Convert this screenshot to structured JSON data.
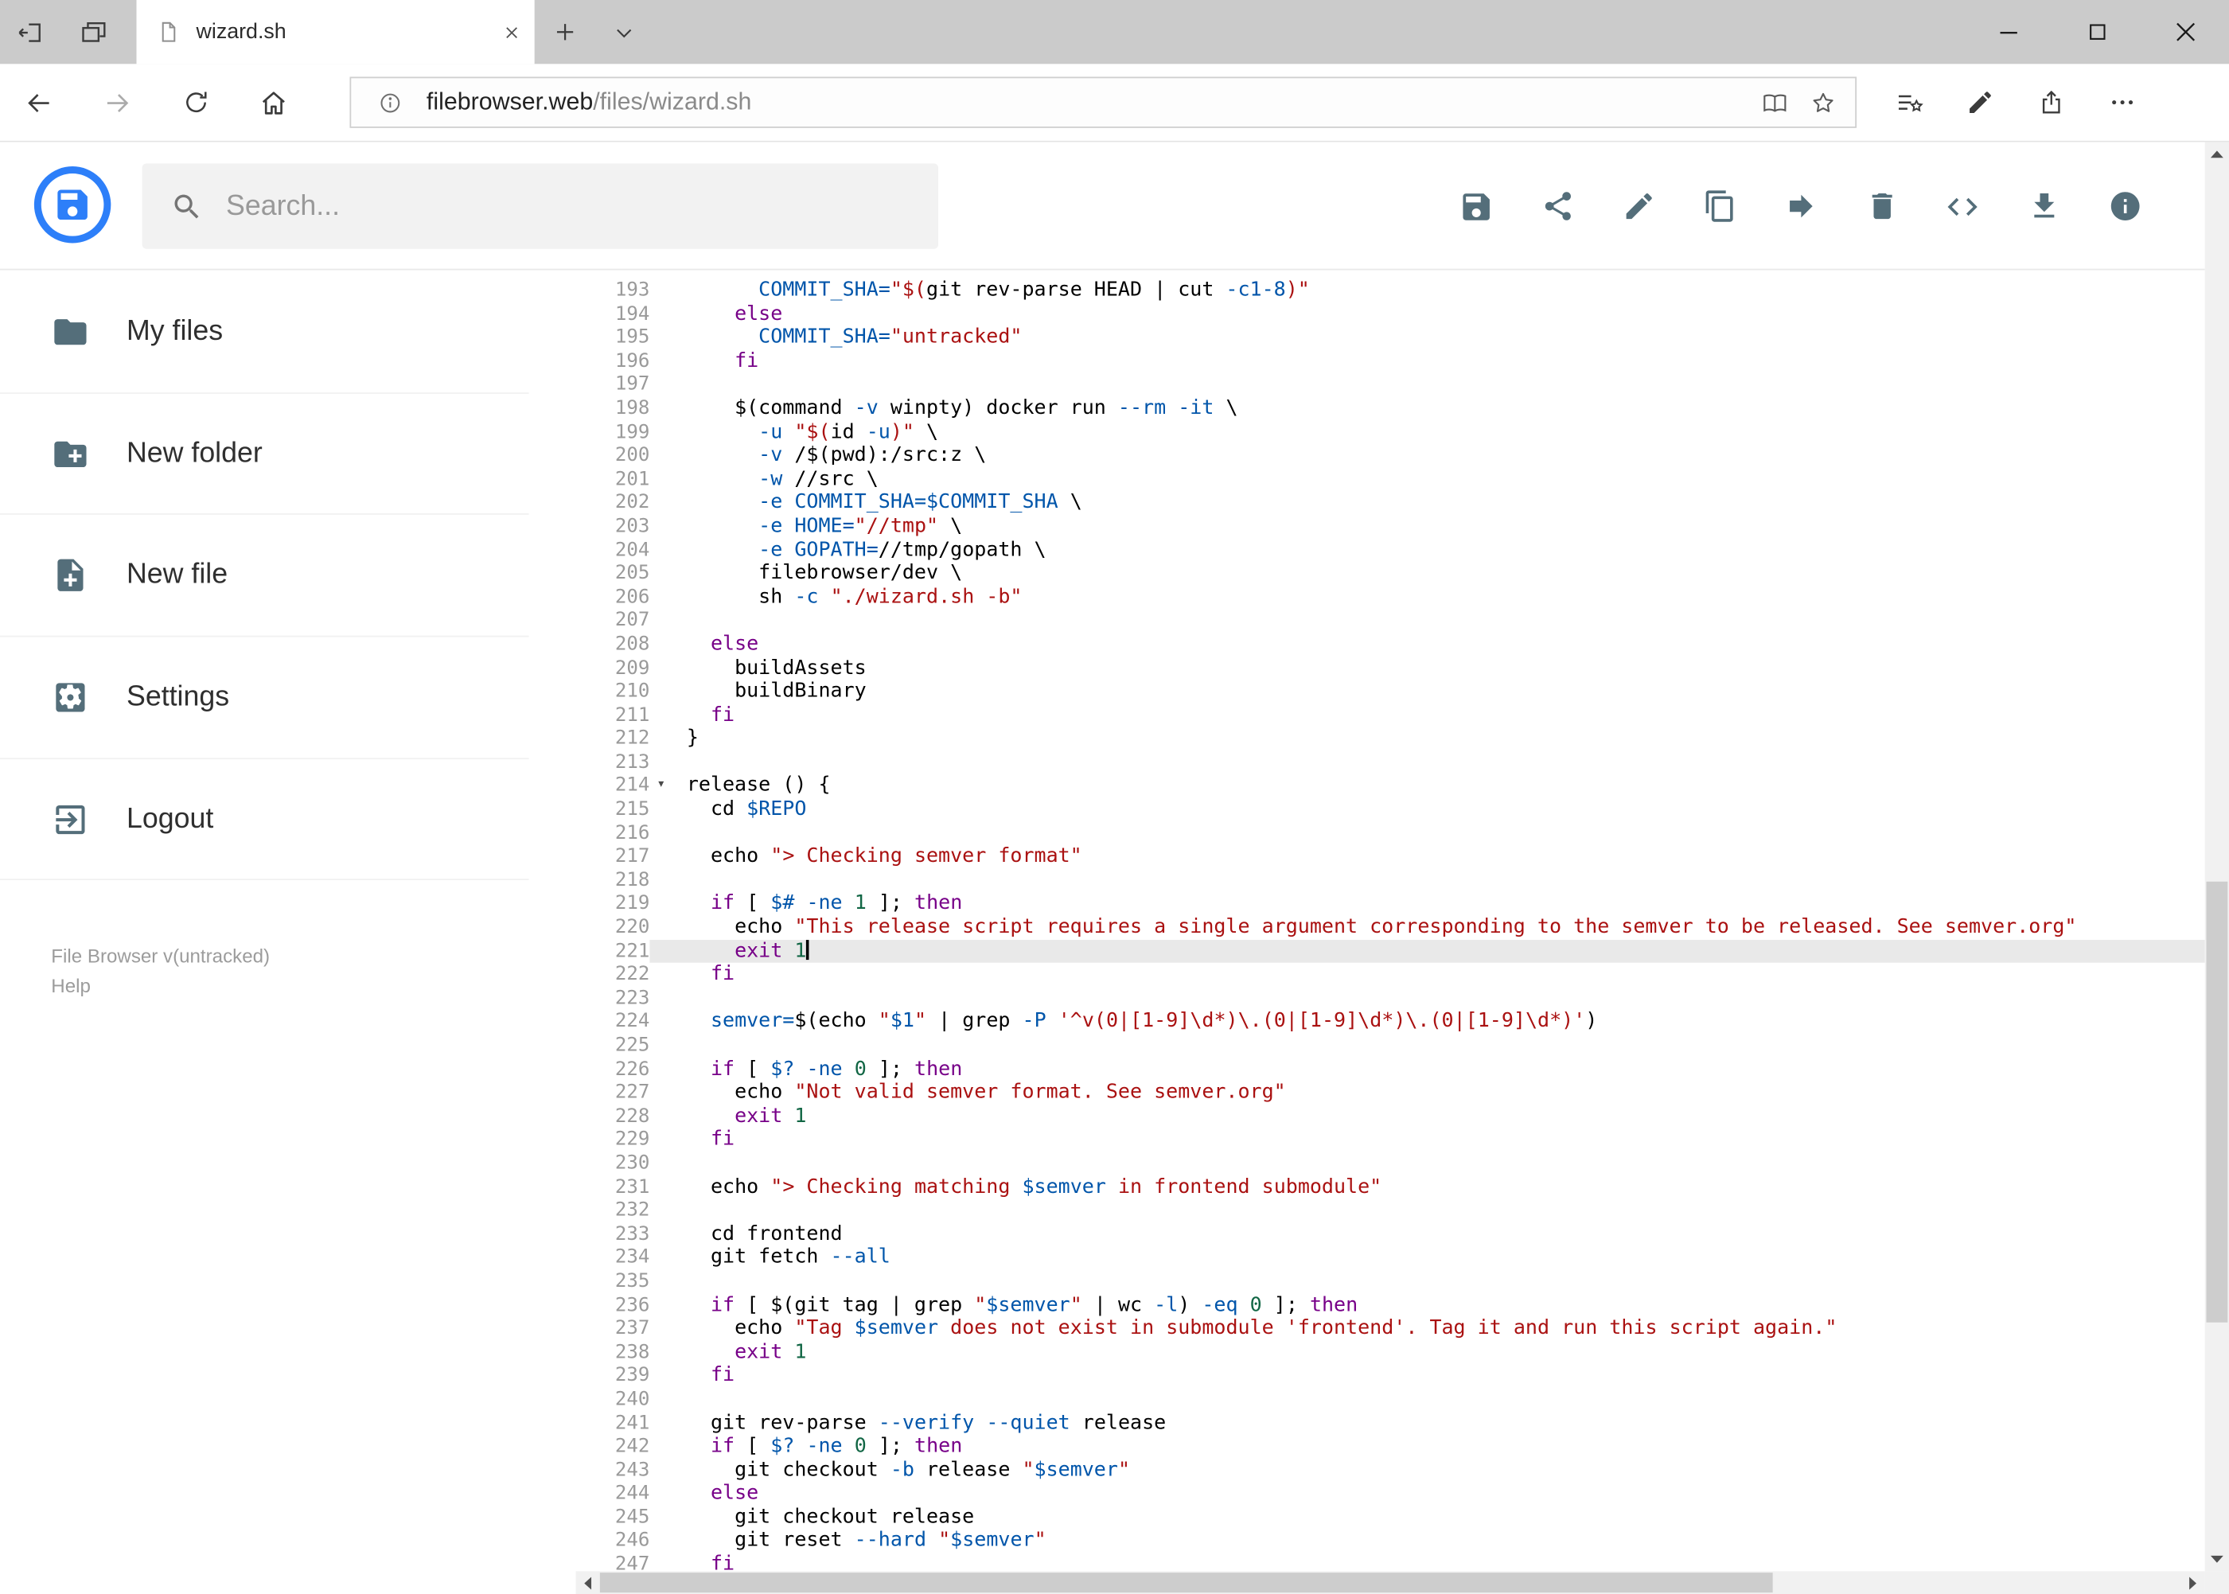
{
  "browser": {
    "tab_title": "wizard.sh",
    "url_domain": "filebrowser.web",
    "url_path": "/files/wizard.sh",
    "window_controls": [
      "minimize",
      "maximize",
      "close"
    ],
    "nav_icons": [
      "back",
      "forward",
      "refresh",
      "home"
    ],
    "url_icons": [
      "page-info",
      "reading-view",
      "favorite-star"
    ],
    "toolbar_icons": [
      "hub-favorites",
      "web-note-pen",
      "share",
      "more-menu"
    ]
  },
  "header": {
    "search_placeholder": "Search...",
    "accent_color": "#2d7ff9",
    "icon_color": "#546e7a",
    "actions": [
      "save",
      "share",
      "rename",
      "copy",
      "move",
      "delete",
      "raw-view",
      "download",
      "info"
    ]
  },
  "sidebar": {
    "items": [
      {
        "icon": "folder-icon",
        "label": "My files"
      },
      {
        "icon": "new-folder-icon",
        "label": "New folder"
      },
      {
        "icon": "new-file-icon",
        "label": "New file"
      },
      {
        "icon": "settings-icon",
        "label": "Settings"
      },
      {
        "icon": "logout-icon",
        "label": "Logout"
      }
    ],
    "footer_version": "File Browser v(untracked)",
    "footer_help": "Help"
  },
  "editor": {
    "language": "shell",
    "active_line": 221,
    "token_colors": {
      "kw": "#770088",
      "str": "#aa1111",
      "var": "#0055aa",
      "num": "#116644",
      "pln": "#000000"
    },
    "lines": [
      {
        "n": 193,
        "i": 6,
        "t": [
          [
            "var",
            "COMMIT_SHA="
          ],
          [
            "str",
            "\"$("
          ],
          [
            "pln",
            "git rev-parse HEAD | cut "
          ],
          [
            "var",
            "-c1-8"
          ],
          [
            "str",
            ")\""
          ]
        ]
      },
      {
        "n": 194,
        "i": 4,
        "t": [
          [
            "kw",
            "else"
          ]
        ]
      },
      {
        "n": 195,
        "i": 6,
        "t": [
          [
            "var",
            "COMMIT_SHA="
          ],
          [
            "str",
            "\"untracked\""
          ]
        ]
      },
      {
        "n": 196,
        "i": 4,
        "t": [
          [
            "kw",
            "fi"
          ]
        ]
      },
      {
        "n": 197,
        "i": 0,
        "t": []
      },
      {
        "n": 198,
        "i": 4,
        "t": [
          [
            "pln",
            "$(command "
          ],
          [
            "var",
            "-v"
          ],
          [
            "pln",
            " winpty) docker run "
          ],
          [
            "var",
            "--rm"
          ],
          [
            "pln",
            " "
          ],
          [
            "var",
            "-it"
          ],
          [
            "pln",
            " \\"
          ]
        ]
      },
      {
        "n": 199,
        "i": 6,
        "t": [
          [
            "var",
            "-u"
          ],
          [
            "pln",
            " "
          ],
          [
            "str",
            "\"$("
          ],
          [
            "pln",
            "id "
          ],
          [
            "var",
            "-u"
          ],
          [
            "str",
            ")\""
          ],
          [
            "pln",
            " \\"
          ]
        ]
      },
      {
        "n": 200,
        "i": 6,
        "t": [
          [
            "var",
            "-v"
          ],
          [
            "pln",
            " /$(pwd):/src:z \\"
          ]
        ]
      },
      {
        "n": 201,
        "i": 6,
        "t": [
          [
            "var",
            "-w"
          ],
          [
            "pln",
            " //src \\"
          ]
        ]
      },
      {
        "n": 202,
        "i": 6,
        "t": [
          [
            "var",
            "-e"
          ],
          [
            "pln",
            " "
          ],
          [
            "var",
            "COMMIT_SHA=$COMMIT_SHA"
          ],
          [
            "pln",
            " \\"
          ]
        ]
      },
      {
        "n": 203,
        "i": 6,
        "t": [
          [
            "var",
            "-e"
          ],
          [
            "pln",
            " "
          ],
          [
            "var",
            "HOME="
          ],
          [
            "str",
            "\"//tmp\""
          ],
          [
            "pln",
            " \\"
          ]
        ]
      },
      {
        "n": 204,
        "i": 6,
        "t": [
          [
            "var",
            "-e"
          ],
          [
            "pln",
            " "
          ],
          [
            "var",
            "GOPATH="
          ],
          [
            "pln",
            "//tmp/gopath \\"
          ]
        ]
      },
      {
        "n": 205,
        "i": 6,
        "t": [
          [
            "pln",
            "filebrowser/dev \\"
          ]
        ]
      },
      {
        "n": 206,
        "i": 6,
        "t": [
          [
            "pln",
            "sh "
          ],
          [
            "var",
            "-c"
          ],
          [
            "pln",
            " "
          ],
          [
            "str",
            "\"./wizard.sh -b\""
          ]
        ]
      },
      {
        "n": 207,
        "i": 0,
        "t": []
      },
      {
        "n": 208,
        "i": 2,
        "t": [
          [
            "kw",
            "else"
          ]
        ]
      },
      {
        "n": 209,
        "i": 4,
        "t": [
          [
            "pln",
            "buildAssets"
          ]
        ]
      },
      {
        "n": 210,
        "i": 4,
        "t": [
          [
            "pln",
            "buildBinary"
          ]
        ]
      },
      {
        "n": 211,
        "i": 2,
        "t": [
          [
            "kw",
            "fi"
          ]
        ]
      },
      {
        "n": 212,
        "i": 0,
        "t": [
          [
            "pln",
            "}"
          ]
        ]
      },
      {
        "n": 213,
        "i": 0,
        "t": []
      },
      {
        "n": 214,
        "i": 0,
        "fold": true,
        "t": [
          [
            "pln",
            "release () {"
          ]
        ]
      },
      {
        "n": 215,
        "i": 2,
        "t": [
          [
            "pln",
            "cd "
          ],
          [
            "var",
            "$REPO"
          ]
        ]
      },
      {
        "n": 216,
        "i": 0,
        "t": []
      },
      {
        "n": 217,
        "i": 2,
        "t": [
          [
            "pln",
            "echo "
          ],
          [
            "str",
            "\"> Checking semver format\""
          ]
        ]
      },
      {
        "n": 218,
        "i": 0,
        "t": []
      },
      {
        "n": 219,
        "i": 2,
        "t": [
          [
            "kw",
            "if"
          ],
          [
            "pln",
            " [ "
          ],
          [
            "var",
            "$#"
          ],
          [
            "pln",
            " "
          ],
          [
            "var",
            "-ne"
          ],
          [
            "pln",
            " "
          ],
          [
            "num",
            "1"
          ],
          [
            "pln",
            " ]; "
          ],
          [
            "kw",
            "then"
          ]
        ]
      },
      {
        "n": 220,
        "i": 4,
        "t": [
          [
            "pln",
            "echo "
          ],
          [
            "str",
            "\"This release script requires a single argument corresponding to the semver to be released. See semver.org\""
          ]
        ]
      },
      {
        "n": 221,
        "i": 4,
        "t": [
          [
            "kw",
            "exit"
          ],
          [
            "pln",
            " "
          ],
          [
            "num",
            "1"
          ]
        ]
      },
      {
        "n": 222,
        "i": 2,
        "t": [
          [
            "kw",
            "fi"
          ]
        ]
      },
      {
        "n": 223,
        "i": 0,
        "t": []
      },
      {
        "n": 224,
        "i": 2,
        "t": [
          [
            "var",
            "semver="
          ],
          [
            "pln",
            "$(echo "
          ],
          [
            "str",
            "\""
          ],
          [
            "var",
            "$1"
          ],
          [
            "str",
            "\""
          ],
          [
            "pln",
            " | grep "
          ],
          [
            "var",
            "-P"
          ],
          [
            "pln",
            " "
          ],
          [
            "str",
            "'^v(0|[1-9]\\d*)\\.(0|[1-9]\\d*)\\.(0|[1-9]\\d*)'"
          ],
          [
            "pln",
            ")"
          ]
        ]
      },
      {
        "n": 225,
        "i": 0,
        "t": []
      },
      {
        "n": 226,
        "i": 2,
        "t": [
          [
            "kw",
            "if"
          ],
          [
            "pln",
            " [ "
          ],
          [
            "var",
            "$?"
          ],
          [
            "pln",
            " "
          ],
          [
            "var",
            "-ne"
          ],
          [
            "pln",
            " "
          ],
          [
            "num",
            "0"
          ],
          [
            "pln",
            " ]; "
          ],
          [
            "kw",
            "then"
          ]
        ]
      },
      {
        "n": 227,
        "i": 4,
        "t": [
          [
            "pln",
            "echo "
          ],
          [
            "str",
            "\"Not valid semver format. See semver.org\""
          ]
        ]
      },
      {
        "n": 228,
        "i": 4,
        "t": [
          [
            "kw",
            "exit"
          ],
          [
            "pln",
            " "
          ],
          [
            "num",
            "1"
          ]
        ]
      },
      {
        "n": 229,
        "i": 2,
        "t": [
          [
            "kw",
            "fi"
          ]
        ]
      },
      {
        "n": 230,
        "i": 0,
        "t": []
      },
      {
        "n": 231,
        "i": 2,
        "t": [
          [
            "pln",
            "echo "
          ],
          [
            "str",
            "\"> Checking matching "
          ],
          [
            "var",
            "$semver"
          ],
          [
            "str",
            " in frontend submodule\""
          ]
        ]
      },
      {
        "n": 232,
        "i": 0,
        "t": []
      },
      {
        "n": 233,
        "i": 2,
        "t": [
          [
            "pln",
            "cd frontend"
          ]
        ]
      },
      {
        "n": 234,
        "i": 2,
        "t": [
          [
            "pln",
            "git fetch "
          ],
          [
            "var",
            "--all"
          ]
        ]
      },
      {
        "n": 235,
        "i": 0,
        "t": []
      },
      {
        "n": 236,
        "i": 2,
        "t": [
          [
            "kw",
            "if"
          ],
          [
            "pln",
            " [ $(git tag | grep "
          ],
          [
            "str",
            "\""
          ],
          [
            "var",
            "$semver"
          ],
          [
            "str",
            "\""
          ],
          [
            "pln",
            " | wc "
          ],
          [
            "var",
            "-l"
          ],
          [
            "pln",
            ") "
          ],
          [
            "var",
            "-eq"
          ],
          [
            "pln",
            " "
          ],
          [
            "num",
            "0"
          ],
          [
            "pln",
            " ]; "
          ],
          [
            "kw",
            "then"
          ]
        ]
      },
      {
        "n": 237,
        "i": 4,
        "t": [
          [
            "pln",
            "echo "
          ],
          [
            "str",
            "\"Tag "
          ],
          [
            "var",
            "$semver"
          ],
          [
            "str",
            " does not exist in submodule 'frontend'. Tag it and run this script again.\""
          ]
        ]
      },
      {
        "n": 238,
        "i": 4,
        "t": [
          [
            "kw",
            "exit"
          ],
          [
            "pln",
            " "
          ],
          [
            "num",
            "1"
          ]
        ]
      },
      {
        "n": 239,
        "i": 2,
        "t": [
          [
            "kw",
            "fi"
          ]
        ]
      },
      {
        "n": 240,
        "i": 0,
        "t": []
      },
      {
        "n": 241,
        "i": 2,
        "t": [
          [
            "pln",
            "git rev-parse "
          ],
          [
            "var",
            "--verify"
          ],
          [
            "pln",
            " "
          ],
          [
            "var",
            "--quiet"
          ],
          [
            "pln",
            " release"
          ]
        ]
      },
      {
        "n": 242,
        "i": 2,
        "t": [
          [
            "kw",
            "if"
          ],
          [
            "pln",
            " [ "
          ],
          [
            "var",
            "$?"
          ],
          [
            "pln",
            " "
          ],
          [
            "var",
            "-ne"
          ],
          [
            "pln",
            " "
          ],
          [
            "num",
            "0"
          ],
          [
            "pln",
            " ]; "
          ],
          [
            "kw",
            "then"
          ]
        ]
      },
      {
        "n": 243,
        "i": 4,
        "t": [
          [
            "pln",
            "git checkout "
          ],
          [
            "var",
            "-b"
          ],
          [
            "pln",
            " release "
          ],
          [
            "str",
            "\""
          ],
          [
            "var",
            "$semver"
          ],
          [
            "str",
            "\""
          ]
        ]
      },
      {
        "n": 244,
        "i": 2,
        "t": [
          [
            "kw",
            "else"
          ]
        ]
      },
      {
        "n": 245,
        "i": 4,
        "t": [
          [
            "pln",
            "git checkout release"
          ]
        ]
      },
      {
        "n": 246,
        "i": 4,
        "t": [
          [
            "pln",
            "git reset "
          ],
          [
            "var",
            "--hard"
          ],
          [
            "pln",
            " "
          ],
          [
            "str",
            "\""
          ],
          [
            "var",
            "$semver"
          ],
          [
            "str",
            "\""
          ]
        ]
      },
      {
        "n": 247,
        "i": 2,
        "t": [
          [
            "kw",
            "fi"
          ]
        ]
      }
    ]
  }
}
